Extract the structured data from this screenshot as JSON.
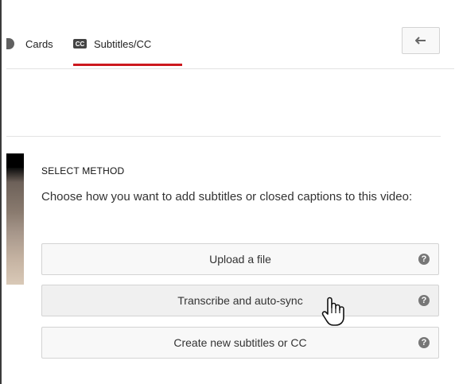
{
  "tabs": {
    "cards_label": "Cards",
    "subtitles_icon": "CC",
    "subtitles_label": "Subtitles/CC"
  },
  "colors": {
    "active_tab_underline": "#cc181e"
  },
  "content": {
    "heading": "SELECT METHOD",
    "description": "Choose how you want to add subtitles or closed captions to this video:",
    "methods": [
      {
        "label": "Upload a file",
        "help": "?"
      },
      {
        "label": "Transcribe and auto-sync",
        "help": "?"
      },
      {
        "label": "Create new subtitles or CC",
        "help": "?"
      }
    ]
  },
  "icons": [
    "back-arrow-icon",
    "cc-icon",
    "help-icon",
    "hand-pointer-cursor-icon"
  ]
}
